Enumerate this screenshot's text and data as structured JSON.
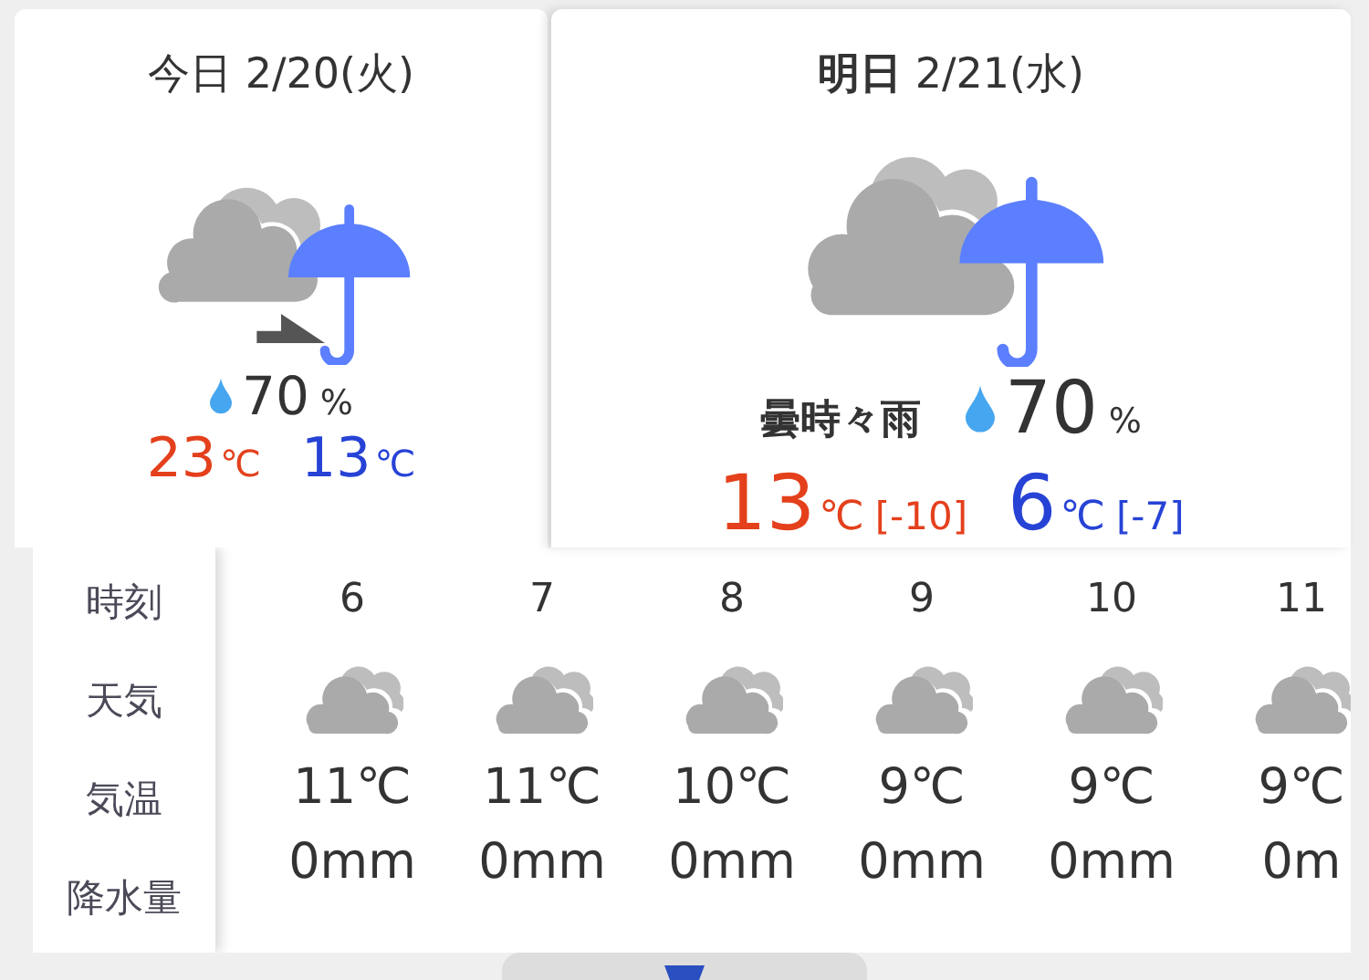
{
  "days": [
    {
      "kind": "compact",
      "title": "今日 2/20(火)",
      "icon": {
        "kind": "cloudthenrain"
      },
      "precip": {
        "value": "70",
        "unit": "%"
      },
      "high": {
        "value": "23",
        "unit": "℃"
      },
      "low": {
        "value": "13",
        "unit": "℃"
      }
    },
    {
      "kind": "detailed",
      "title": "**明日** 2/21(水)",
      "icon": {
        "kind": "cloudrain"
      },
      "condition": "曇時々雨",
      "precip": {
        "value": "70",
        "unit": "%"
      },
      "high": {
        "value": "13",
        "unit": "℃",
        "diff": "[-10]"
      },
      "low": {
        "value": "6",
        "unit": "℃",
        "diff": "[-7]"
      }
    }
  ],
  "hourly": {
    "row_labels": [
      "時刻",
      "天気",
      "気温",
      "降水量"
    ],
    "hours": [
      {
        "time": "6",
        "icon": {
          "kind": "cloudy"
        },
        "temp": "11℃",
        "precip": "0mm"
      },
      {
        "time": "7",
        "icon": {
          "kind": "cloudy"
        },
        "temp": "11℃",
        "precip": "0mm"
      },
      {
        "time": "8",
        "icon": {
          "kind": "cloudy"
        },
        "temp": "10℃",
        "precip": "0mm"
      },
      {
        "time": "9",
        "icon": {
          "kind": "cloudy"
        },
        "temp": "9℃",
        "precip": "0mm"
      },
      {
        "time": "10",
        "icon": {
          "kind": "cloudy"
        },
        "temp": "9℃",
        "precip": "0mm"
      },
      {
        "time": "11",
        "icon": {
          "kind": "cloudy"
        },
        "temp": "9℃",
        "precip": "0m"
      }
    ]
  }
}
